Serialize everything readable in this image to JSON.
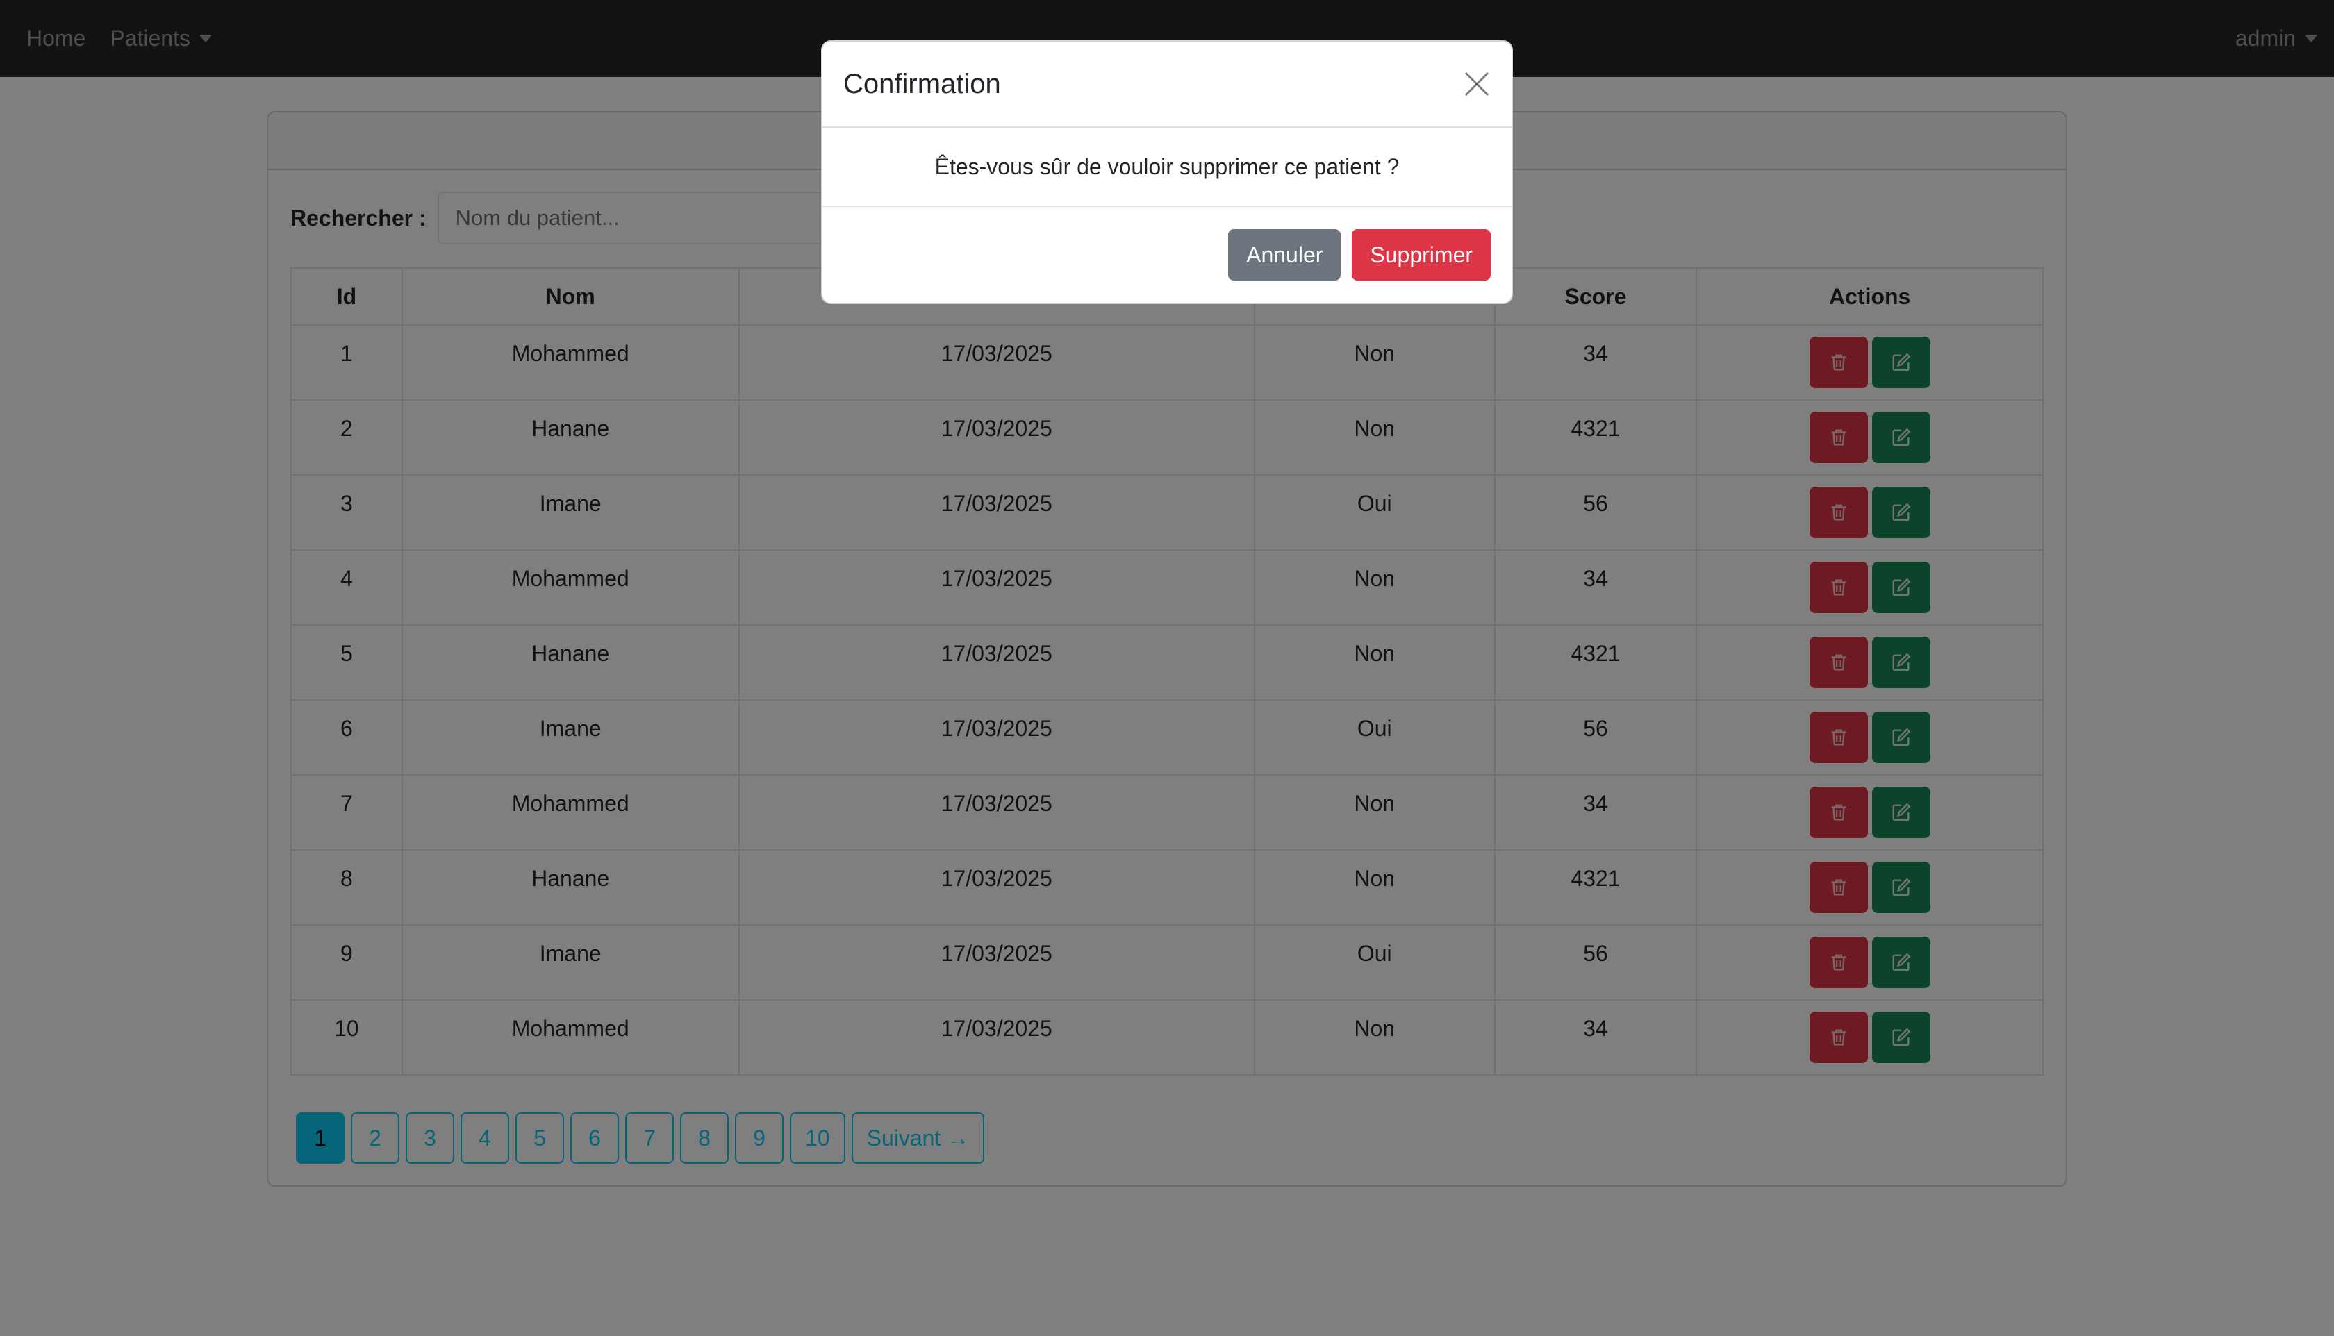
{
  "navbar": {
    "home": "Home",
    "patients": "Patients",
    "user": "admin"
  },
  "search": {
    "label": "Rechercher :",
    "placeholder": "Nom du patient...",
    "value": ""
  },
  "table": {
    "headers": [
      "Id",
      "Nom",
      "",
      "",
      "Score",
      "Actions"
    ],
    "rows": [
      {
        "id": "1",
        "nom": "Mohammed",
        "date": "17/03/2025",
        "malade": "Non",
        "score": "34"
      },
      {
        "id": "2",
        "nom": "Hanane",
        "date": "17/03/2025",
        "malade": "Non",
        "score": "4321"
      },
      {
        "id": "3",
        "nom": "Imane",
        "date": "17/03/2025",
        "malade": "Oui",
        "score": "56"
      },
      {
        "id": "4",
        "nom": "Mohammed",
        "date": "17/03/2025",
        "malade": "Non",
        "score": "34"
      },
      {
        "id": "5",
        "nom": "Hanane",
        "date": "17/03/2025",
        "malade": "Non",
        "score": "4321"
      },
      {
        "id": "6",
        "nom": "Imane",
        "date": "17/03/2025",
        "malade": "Oui",
        "score": "56"
      },
      {
        "id": "7",
        "nom": "Mohammed",
        "date": "17/03/2025",
        "malade": "Non",
        "score": "34"
      },
      {
        "id": "8",
        "nom": "Hanane",
        "date": "17/03/2025",
        "malade": "Non",
        "score": "4321"
      },
      {
        "id": "9",
        "nom": "Imane",
        "date": "17/03/2025",
        "malade": "Oui",
        "score": "56"
      },
      {
        "id": "10",
        "nom": "Mohammed",
        "date": "17/03/2025",
        "malade": "Non",
        "score": "34"
      }
    ],
    "row_actions": [
      "trash-icon",
      "edit-icon"
    ]
  },
  "pagination": {
    "pages": [
      "1",
      "2",
      "3",
      "4",
      "5",
      "6",
      "7",
      "8",
      "9",
      "10"
    ],
    "current": "1",
    "next_label": "Suivant →"
  },
  "modal": {
    "title": "Confirmation",
    "message": "Êtes-vous sûr de vouloir supprimer ce patient ?",
    "cancel_label": "Annuler",
    "confirm_label": "Supprimer"
  },
  "colors": {
    "navbar": "#212529",
    "danger": "#dc3545",
    "success": "#198754",
    "info": "#0dcaf0",
    "secondary": "#6c757d"
  }
}
